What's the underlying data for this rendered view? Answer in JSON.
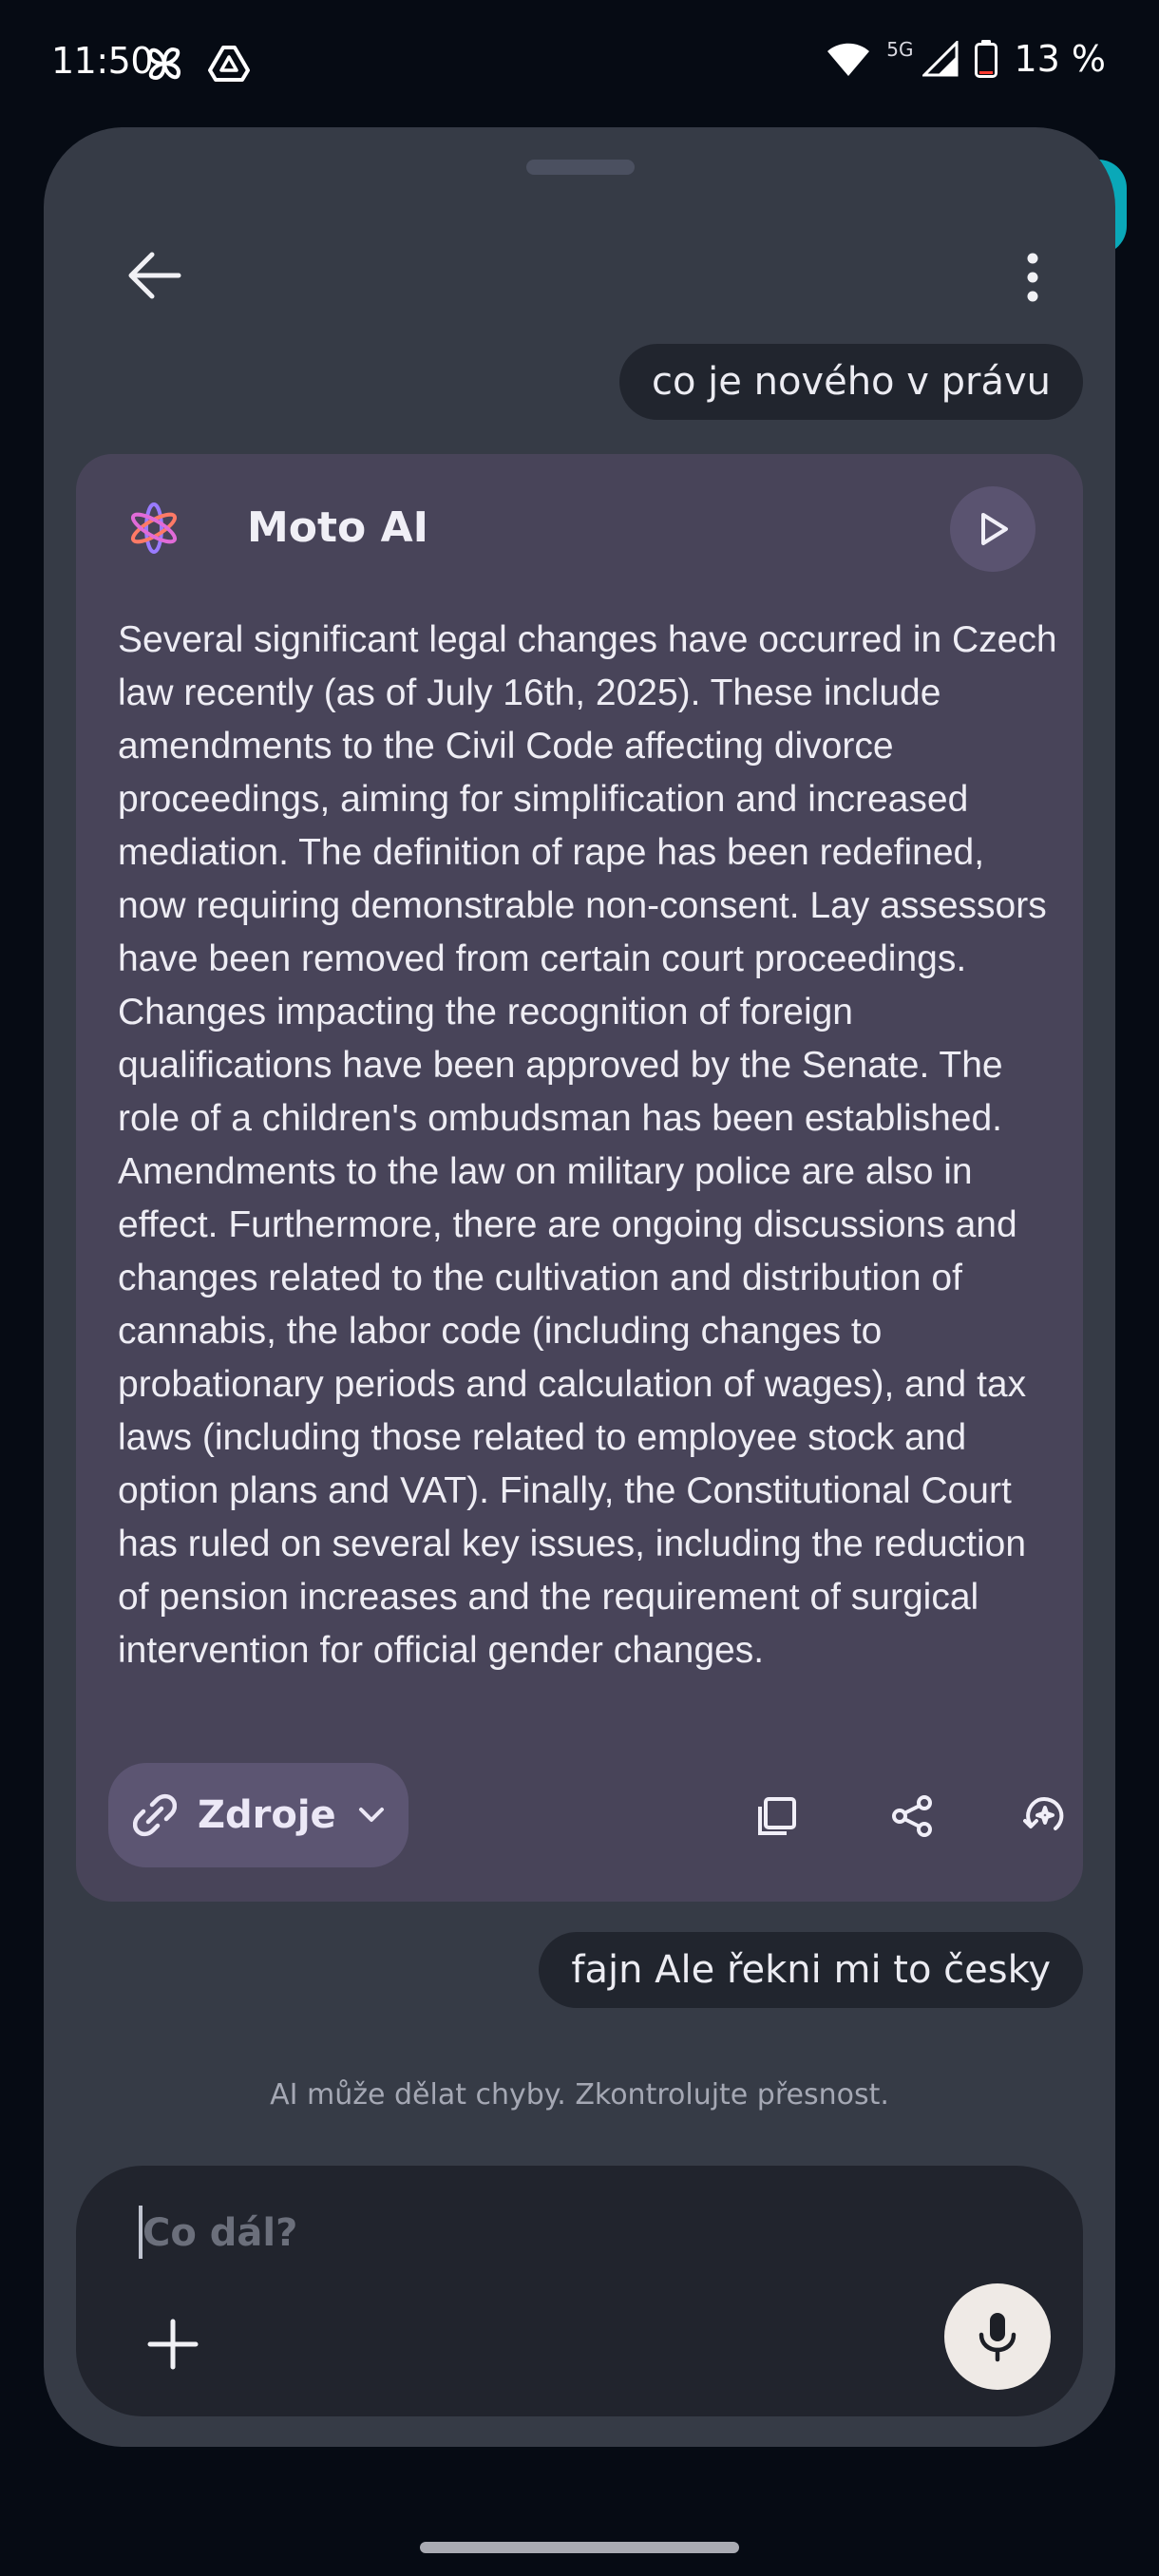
{
  "status_bar": {
    "time": "11:50",
    "left_icons": [
      "pinwheel-icon",
      "drive-icon"
    ],
    "network": "5G",
    "battery": "13 %",
    "battery_level": 0.13
  },
  "header": {
    "back_icon": "arrow-left-icon",
    "menu_icon": "more-vert-icon"
  },
  "conversation": {
    "user_message_1": "co je nového v právu",
    "assistant": {
      "name": "Moto AI",
      "logo_icon": "moto-ai-logo-icon",
      "play_icon": "play-icon",
      "response": "Several significant legal changes have occurred in Czech law recently (as of July 16th, 2025). These include amendments to the Civil Code affecting divorce proceedings, aiming for simplification and increased mediation. The definition of rape has been redefined, now requiring demonstrable non-consent. Lay assessors have been removed from certain court proceedings. Changes impacting the recognition of foreign qualifications have been approved by the Senate. The role of a children's ombudsman has been established. Amendments to the law on military police are also in effect. Furthermore, there are ongoing discussions and changes related to the cultivation and distribution of cannabis, the labor code (including changes to probationary periods and calculation of wages), and tax laws (including those related to employee stock and option plans and VAT). Finally, the Constitutional Court has ruled on several key issues, including the reduction of pension increases and the requirement of surgical intervention for official gender changes.",
      "sources_label": "Zdroje",
      "actions": [
        "copy-icon",
        "share-icon",
        "regenerate-icon"
      ]
    },
    "user_message_2": "fajn Ale řekni mi to česky"
  },
  "disclaimer": "AI může dělat chyby. Zkontrolujte přesnost.",
  "composer": {
    "placeholder": "Co dál?",
    "value": "",
    "add_icon": "plus-icon",
    "mic_icon": "microphone-icon"
  },
  "colors": {
    "background": "#060b14",
    "sheet": "#363b46",
    "ai_card": "#484459",
    "user_bubble": "#21252e",
    "accent_teal": "#0aa8b8",
    "mic_button": "#efeae6"
  }
}
